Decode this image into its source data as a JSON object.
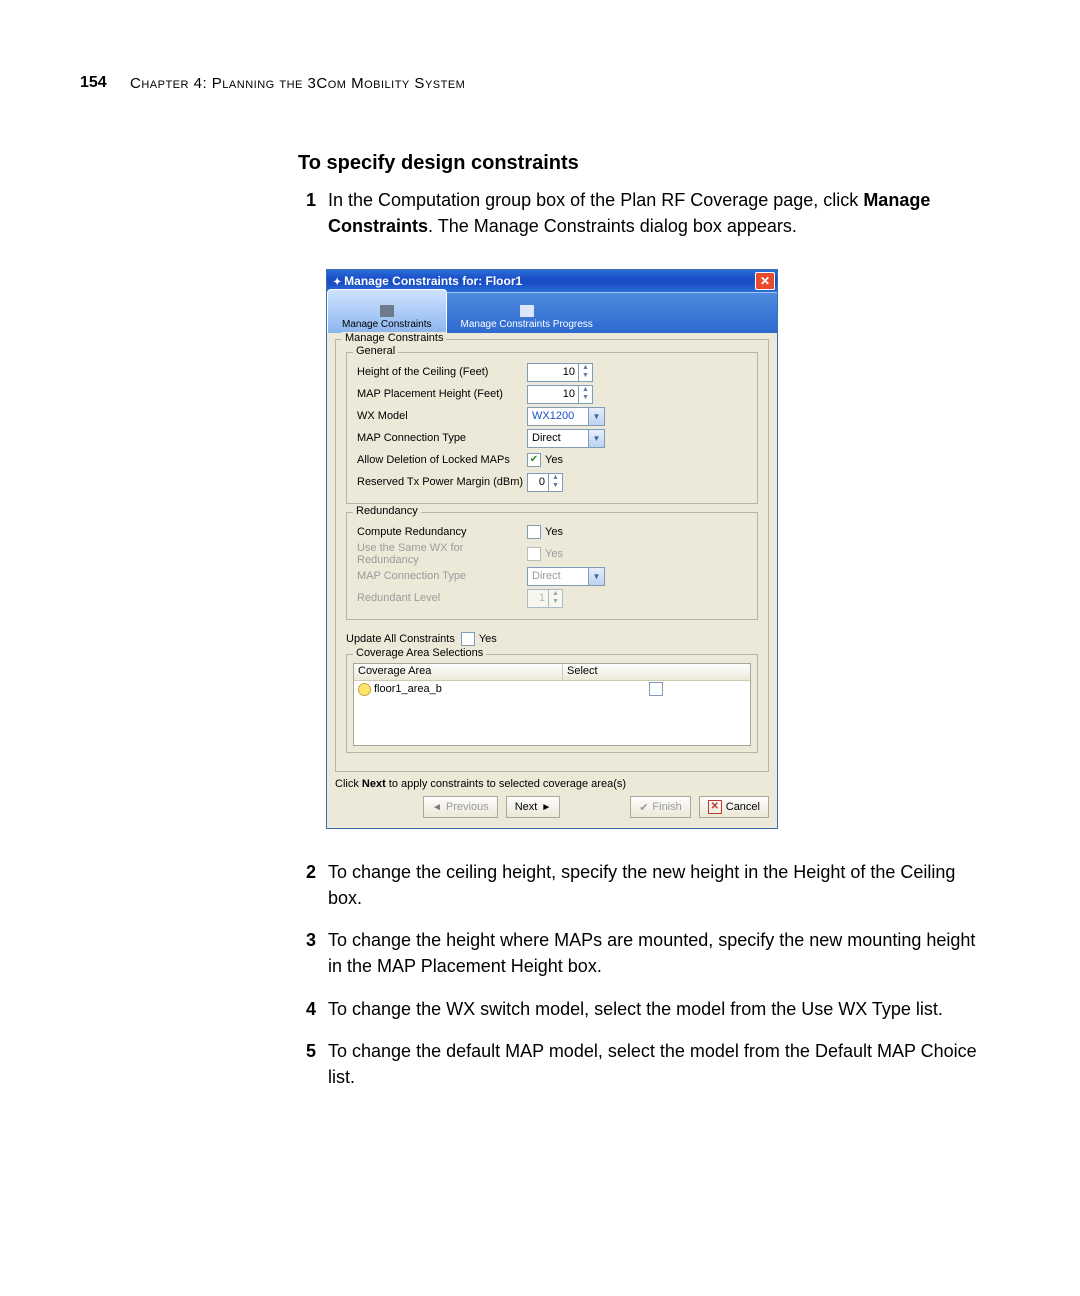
{
  "page_number": "154",
  "chapter_head": "Chapter 4: Planning the 3Com Mobility System",
  "heading": "To specify design constraints",
  "steps": {
    "s1_a": "In the Computation group box of the Plan RF Coverage page, click ",
    "s1_b": "Manage Constraints",
    "s1_c": ". The Manage Constraints dialog box appears.",
    "s2": "To change the ceiling height, specify the new height in the Height of the Ceiling box.",
    "s3": "To change the height where MAPs are mounted, specify the new mounting height in the MAP Placement Height box.",
    "s4": "To change the WX switch model, select the model from the Use WX Type list.",
    "s5": "To change the default MAP model, select the model from the Default MAP Choice list."
  },
  "nums": {
    "n1": "1",
    "n2": "2",
    "n3": "3",
    "n4": "4",
    "n5": "5"
  },
  "dlg": {
    "title": "Manage Constraints for: Floor1",
    "tab1": "Manage Constraints",
    "tab2": "Manage Constraints Progress",
    "grp_main": "Manage Constraints",
    "grp_general": "General",
    "row_ceiling": "Height of the Ceiling (Feet)",
    "val_ceiling": "10",
    "row_mapheight": "MAP Placement Height (Feet)",
    "val_mapheight": "10",
    "row_wxmodel": "WX Model",
    "val_wxmodel": "WX1200",
    "row_conntype": "MAP Connection Type",
    "val_conntype": "Direct",
    "row_allowdel": "Allow Deletion of Locked MAPs",
    "chk_yes": "Yes",
    "row_txmargin": "Reserved Tx Power Margin (dBm)",
    "val_txmargin": "0",
    "grp_redund": "Redundancy",
    "row_compred": "Compute Redundancy",
    "row_samewx": "Use the Same WX for Redundancy",
    "row_conntype2": "MAP Connection Type",
    "val_conntype2": "Direct",
    "row_redlevel": "Redundant Level",
    "val_redlevel": "1",
    "row_updateall": "Update All Constraints",
    "grp_cov": "Coverage Area Selections",
    "col_area": "Coverage Area",
    "col_select": "Select",
    "area_row": "floor1_area_b",
    "note_a": "Click ",
    "note_b": "Next",
    "note_c": " to apply constraints to selected coverage area(s)",
    "btn_prev": "Previous",
    "btn_next": "Next",
    "btn_finish": "Finish",
    "btn_cancel": "Cancel"
  }
}
